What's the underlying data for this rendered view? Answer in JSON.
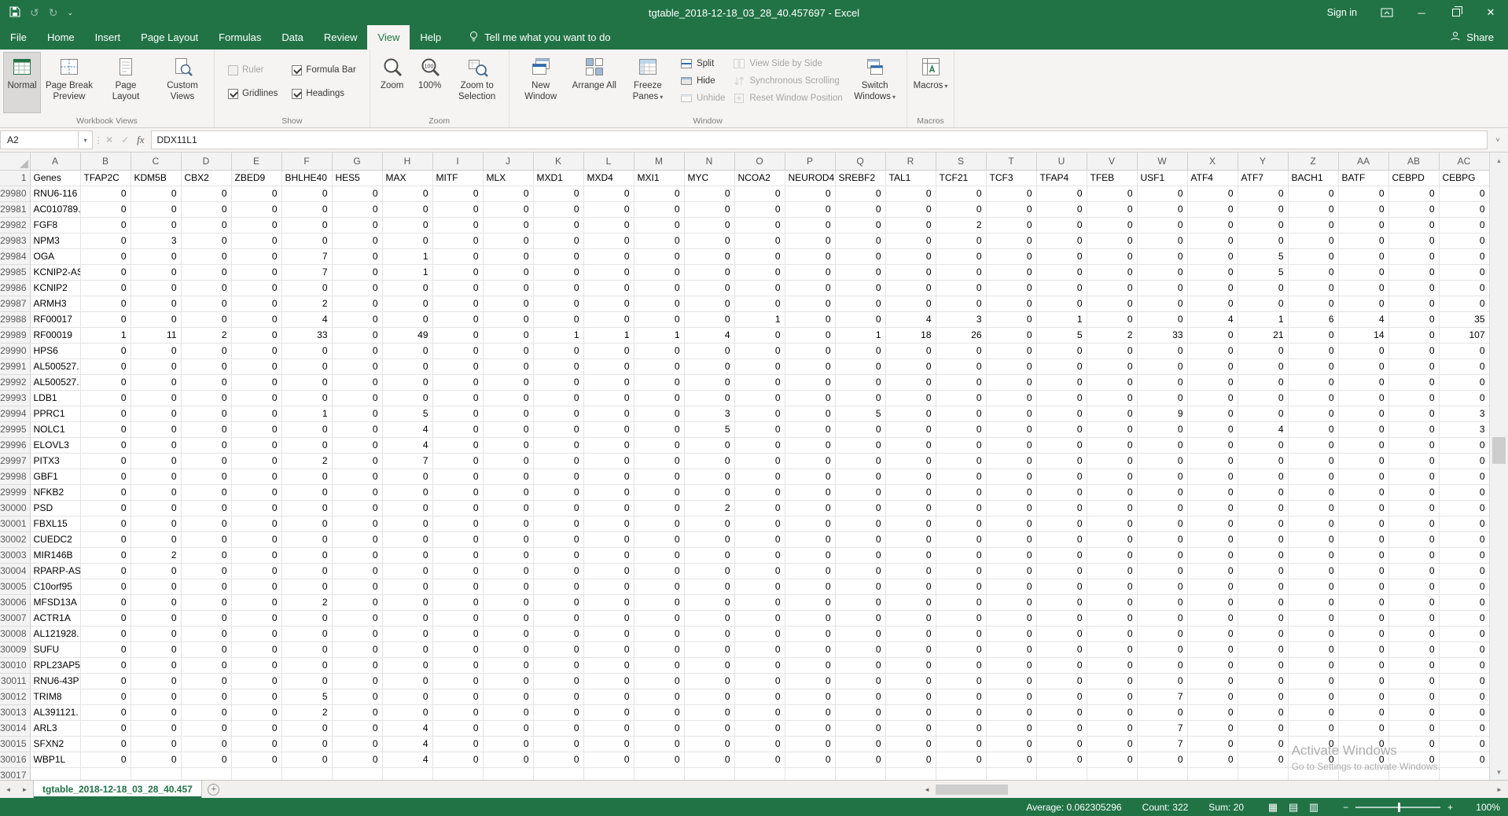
{
  "colors": {
    "excel_green": "#217346",
    "ribbon_bg": "#f5f4f2",
    "grid_line": "#e4e4e4",
    "header_bg": "#f3f3f3"
  },
  "titlebar": {
    "title": "tgtable_2018-12-18_03_28_40.457697 - Excel",
    "sign_in": "Sign in"
  },
  "menubar": {
    "tabs": [
      "File",
      "Home",
      "Insert",
      "Page Layout",
      "Formulas",
      "Data",
      "Review",
      "View",
      "Help"
    ],
    "active_tab": "View",
    "tell_me": "Tell me what you want to do",
    "share": "Share"
  },
  "ribbon": {
    "group_labels": [
      "Workbook Views",
      "Show",
      "Zoom",
      "Window",
      "Macros"
    ],
    "workbook_views": [
      "Normal",
      "Page Break Preview",
      "Page Layout",
      "Custom Views"
    ],
    "selected_view": "Normal",
    "show": [
      {
        "label": "Ruler",
        "checked": false,
        "disabled": true
      },
      {
        "label": "Formula Bar",
        "checked": true,
        "disabled": false
      },
      {
        "label": "Gridlines",
        "checked": true,
        "disabled": false
      },
      {
        "label": "Headings",
        "checked": true,
        "disabled": false
      }
    ],
    "zoom": [
      "Zoom",
      "100%",
      "Zoom to Selection"
    ],
    "window": [
      "New Window",
      "Arrange All",
      "Freeze Panes",
      "Split",
      "Hide",
      "Unhide",
      "View Side by Side",
      "Synchronous Scrolling",
      "Reset Window Position",
      "Switch Windows"
    ],
    "macros": "Macros"
  },
  "formula_bar": {
    "name_box": "A2",
    "formula": "DDX11L1",
    "fx_label": "fx",
    "cancel_glyph": "✕",
    "enter_glyph": "✓"
  },
  "grid": {
    "column_letters": [
      "A",
      "B",
      "C",
      "D",
      "E",
      "F",
      "G",
      "H",
      "I",
      "J",
      "K",
      "L",
      "M",
      "N",
      "O",
      "P",
      "Q",
      "R",
      "S",
      "T",
      "U",
      "V",
      "W",
      "X",
      "Y",
      "Z",
      "AA",
      "AB",
      "AC"
    ],
    "header_row_number": 1,
    "header_row": [
      "Genes",
      "TFAP2C",
      "KDM5B",
      "CBX2",
      "ZBED9",
      "BHLHE40",
      "HES5",
      "MAX",
      "MITF",
      "MLX",
      "MXD1",
      "MXD4",
      "MXI1",
      "MYC",
      "NCOA2",
      "NEUROD4",
      "SREBF2",
      "TAL1",
      "TCF21",
      "TCF3",
      "TFAP4",
      "TFEB",
      "USF1",
      "ATF4",
      "ATF7",
      "BACH1",
      "BATF",
      "CEBPD",
      "CEBPG"
    ],
    "columns": [
      "TFAP2C",
      "KDM5B",
      "CBX2",
      "ZBED9",
      "BHLHE40",
      "HES5",
      "MAX",
      "MITF",
      "MLX",
      "MXD1",
      "MXD4",
      "MXI1",
      "MYC",
      "NCOA2",
      "NEUROD4",
      "SREBF2",
      "TAL1",
      "TCF21",
      "TCF3",
      "TFAP4",
      "TFEB",
      "USF1",
      "ATF4",
      "ATF7",
      "BACH1",
      "BATF",
      "CEBPD",
      "CEBPG"
    ],
    "default_cell_value": 0,
    "partial_next_row": 30017,
    "rows": [
      {
        "row": 29980,
        "gene": "RNU6-116",
        "values": {}
      },
      {
        "row": 29981,
        "gene": "AC010789.",
        "values": {}
      },
      {
        "row": 29982,
        "gene": "FGF8",
        "values": {
          "TCF21": 2
        }
      },
      {
        "row": 29983,
        "gene": "NPM3",
        "values": {
          "KDM5B": 3
        }
      },
      {
        "row": 29984,
        "gene": "OGA",
        "values": {
          "BHLHE40": 7,
          "MAX": 1,
          "ATF7": 5
        }
      },
      {
        "row": 29985,
        "gene": "KCNIP2-AS",
        "values": {
          "BHLHE40": 7,
          "MAX": 1,
          "ATF7": 5
        }
      },
      {
        "row": 29986,
        "gene": "KCNIP2",
        "values": {}
      },
      {
        "row": 29987,
        "gene": "ARMH3",
        "values": {
          "BHLHE40": 2
        }
      },
      {
        "row": 29988,
        "gene": "RF00017",
        "values": {
          "BHLHE40": 4,
          "NCOA2": 1,
          "TAL1": 4,
          "TCF21": 3,
          "TFAP4": 1,
          "ATF4": 4,
          "ATF7": 1,
          "BACH1": 6,
          "BATF": 4,
          "CEBPG": 35
        }
      },
      {
        "row": 29989,
        "gene": "RF00019",
        "values": {
          "TFAP2C": 1,
          "KDM5B": 11,
          "CBX2": 2,
          "BHLHE40": 33,
          "MAX": 49,
          "MXD1": 1,
          "MXD4": 1,
          "MXI1": 1,
          "MYC": 4,
          "SREBF2": 1,
          "TAL1": 18,
          "TCF21": 26,
          "TFAP4": 5,
          "TFEB": 2,
          "USF1": 33,
          "ATF7": 21,
          "BATF": 14,
          "CEBPG": 107
        }
      },
      {
        "row": 29990,
        "gene": "HPS6",
        "values": {}
      },
      {
        "row": 29991,
        "gene": "AL500527.",
        "values": {}
      },
      {
        "row": 29992,
        "gene": "AL500527.",
        "values": {}
      },
      {
        "row": 29993,
        "gene": "LDB1",
        "values": {}
      },
      {
        "row": 29994,
        "gene": "PPRC1",
        "values": {
          "BHLHE40": 1,
          "MAX": 5,
          "MYC": 3,
          "SREBF2": 5,
          "USF1": 9,
          "CEBPG": 3
        }
      },
      {
        "row": 29995,
        "gene": "NOLC1",
        "values": {
          "MAX": 4,
          "MYC": 5,
          "ATF7": 4,
          "CEBPG": 3
        }
      },
      {
        "row": 29996,
        "gene": "ELOVL3",
        "values": {
          "MAX": 4
        }
      },
      {
        "row": 29997,
        "gene": "PITX3",
        "values": {
          "BHLHE40": 2,
          "MAX": 7
        }
      },
      {
        "row": 29998,
        "gene": "GBF1",
        "values": {}
      },
      {
        "row": 29999,
        "gene": "NFKB2",
        "values": {}
      },
      {
        "row": 30000,
        "gene": "PSD",
        "values": {
          "MYC": 2
        }
      },
      {
        "row": 30001,
        "gene": "FBXL15",
        "values": {}
      },
      {
        "row": 30002,
        "gene": "CUEDC2",
        "values": {}
      },
      {
        "row": 30003,
        "gene": "MIR146B",
        "values": {
          "KDM5B": 2
        }
      },
      {
        "row": 30004,
        "gene": "RPARP-AS",
        "values": {}
      },
      {
        "row": 30005,
        "gene": "C10orf95",
        "values": {}
      },
      {
        "row": 30006,
        "gene": "MFSD13A",
        "values": {
          "BHLHE40": 2
        }
      },
      {
        "row": 30007,
        "gene": "ACTR1A",
        "values": {}
      },
      {
        "row": 30008,
        "gene": "AL121928.",
        "values": {}
      },
      {
        "row": 30009,
        "gene": "SUFU",
        "values": {}
      },
      {
        "row": 30010,
        "gene": "RPL23AP5",
        "values": {}
      },
      {
        "row": 30011,
        "gene": "RNU6-43P",
        "values": {}
      },
      {
        "row": 30012,
        "gene": "TRIM8",
        "values": {
          "BHLHE40": 5,
          "USF1": 7
        }
      },
      {
        "row": 30013,
        "gene": "AL391121.",
        "values": {
          "BHLHE40": 2
        }
      },
      {
        "row": 30014,
        "gene": "ARL3",
        "values": {
          "MAX": 4,
          "USF1": 7
        }
      },
      {
        "row": 30015,
        "gene": "SFXN2",
        "values": {
          "MAX": 4,
          "USF1": 7
        }
      },
      {
        "row": 30016,
        "gene": "WBP1L",
        "values": {
          "MAX": 4
        }
      }
    ]
  },
  "sheet_tabs": {
    "active": "tgtable_2018-12-18_03_28_40.457"
  },
  "status_bar": {
    "average": "Average: 0.062305296",
    "count": "Count: 322",
    "sum": "Sum: 20",
    "zoom_level": "100%"
  },
  "watermark": {
    "line1": "Activate Windows",
    "line2": "Go to Settings to activate Windows."
  }
}
